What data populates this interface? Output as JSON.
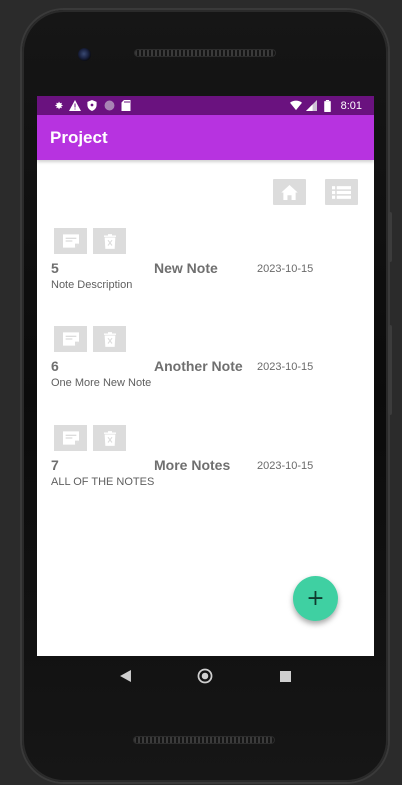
{
  "status_bar": {
    "time": "8:01",
    "left_icons": [
      "gear-icon",
      "warning-icon",
      "shield-icon",
      "circle-icon",
      "sd-card-icon"
    ],
    "right_icons": [
      "wifi-icon",
      "signal-icon",
      "battery-icon"
    ]
  },
  "app_bar": {
    "title": "Project"
  },
  "toolbar": {
    "icons": [
      "home-icon",
      "list-icon"
    ]
  },
  "notes": [
    {
      "id": "5",
      "title": "New Note",
      "date": "2023-10-15",
      "description": "Note Description"
    },
    {
      "id": "6",
      "title": "Another Note",
      "date": "2023-10-15",
      "description": "One More New Note"
    },
    {
      "id": "7",
      "title": "More Notes",
      "date": "2023-10-15",
      "description": "ALL OF THE NOTES"
    }
  ],
  "fab": {
    "label": "+"
  },
  "nav": {
    "icons": [
      "back-icon",
      "home-circle-icon",
      "recents-icon"
    ]
  },
  "colors": {
    "status_bar": "#6a127f",
    "app_bar": "#b733e0",
    "fab": "#3fd0a2",
    "button_bg": "#dcdcdc"
  }
}
